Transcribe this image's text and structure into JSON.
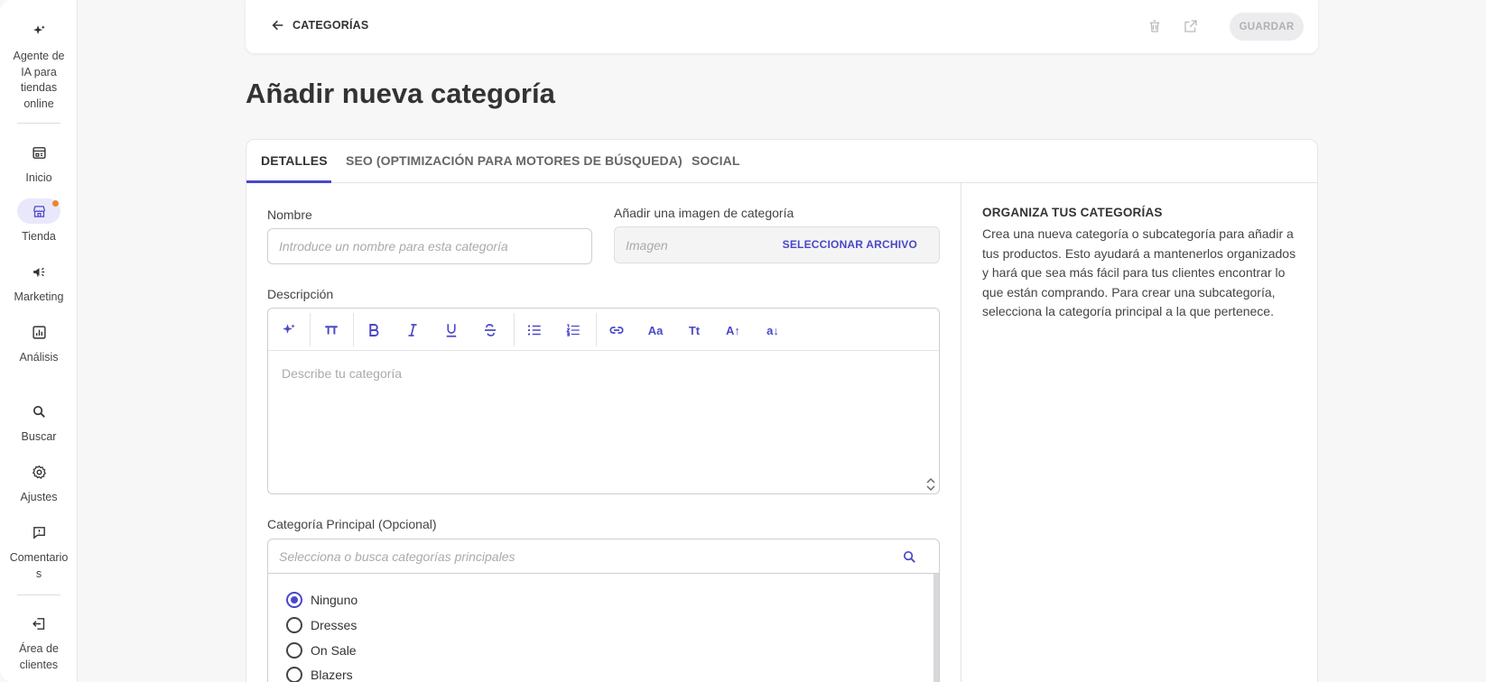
{
  "sidebar": {
    "items": [
      {
        "label": "Agente de IA para tiendas online",
        "icon": "sparkle-icon"
      },
      {
        "label": "Inicio",
        "icon": "home-icon"
      },
      {
        "label": "Tienda",
        "icon": "store-icon"
      },
      {
        "label": "Marketing",
        "icon": "megaphone-icon"
      },
      {
        "label": "Análisis",
        "icon": "chart-icon"
      },
      {
        "label": "Buscar",
        "icon": "search-icon"
      },
      {
        "label": "Ajustes",
        "icon": "gear-icon"
      },
      {
        "label": "Comentarios",
        "icon": "feedback-icon"
      },
      {
        "label": "Área de clientes",
        "icon": "exit-icon"
      }
    ],
    "active": "Tienda",
    "notification_color": "#e8862f"
  },
  "topbar": {
    "back_label": "CATEGORÍAS",
    "save_label": "GUARDAR"
  },
  "page": {
    "title": "Añadir nueva categoría"
  },
  "tabs": [
    {
      "label": "DETALLES",
      "active": true
    },
    {
      "label": "SEO (OPTIMIZACIÓN PARA MOTORES DE BÚSQUEDA)",
      "active": false
    },
    {
      "label": "SOCIAL",
      "active": false
    }
  ],
  "form": {
    "name_label": "Nombre",
    "name_placeholder": "Introduce un nombre para esta categoría",
    "image_label": "Añadir una imagen de categoría",
    "image_placeholder": "Imagen",
    "image_button": "SELECCIONAR ARCHIVO",
    "description_label": "Descripción",
    "description_placeholder": "Describe tu categoría",
    "toolbar": {
      "font_family": "Aa",
      "text_case": "Tt",
      "uppercase": "A↑",
      "lowercase": "a↓"
    },
    "parent_label": "Categoría Principal (Opcional)",
    "parent_placeholder": "Selecciona o busca categorías principales",
    "parent_options": [
      {
        "label": "Ninguno",
        "selected": true
      },
      {
        "label": "Dresses",
        "selected": false
      },
      {
        "label": "On Sale",
        "selected": false
      },
      {
        "label": "Blazers",
        "selected": false
      }
    ]
  },
  "aside": {
    "title": "ORGANIZA TUS CATEGORÍAS",
    "body": "Crea una nueva categoría o subcategoría para añadir a tus productos. Esto ayudará a mantenerlos organizados y hará que sea más fácil para tus clientes encontrar lo que están comprando. Para crear una subcategoría, selecciona la categoría principal a la que pertenece."
  },
  "colors": {
    "accent": "#4a47c8",
    "background": "#f7f7f8"
  }
}
